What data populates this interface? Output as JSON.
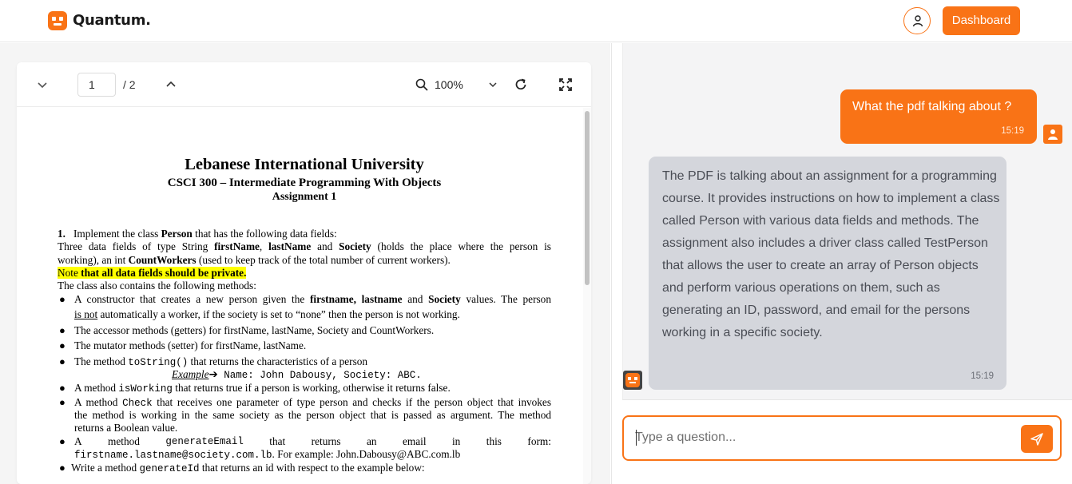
{
  "header": {
    "brand": "Quantum.",
    "dashboard_label": "Dashboard",
    "accent": "#f97316"
  },
  "viewer": {
    "page_current": "1",
    "page_total": "/ 2",
    "zoom": "100%",
    "icons": [
      "chevron-down-icon",
      "chevron-up-icon",
      "search-icon",
      "refresh-icon",
      "fullscreen-icon"
    ]
  },
  "pdf": {
    "title": "Lebanese International University",
    "course": "CSCI 300 – Intermediate Programming With Objects",
    "assignment": "Assignment 1",
    "item1_num": "1.",
    "item1_a": "Implement the class ",
    "item1_b": "Person",
    "item1_c": " that has the following data fields:",
    "fields_a": "Three data fields of type String ",
    "fields_b": "firstName",
    "fields_c": ", ",
    "fields_d": "lastName",
    "fields_e": " and ",
    "fields_f": "Society",
    "fields_g": " (holds the place where the person is",
    "working_a": "working), an int ",
    "working_b": "CountWorkers",
    "working_c": " (used to keep track of the total number of current workers).",
    "note_a": "Note ",
    "note_b": "that all data fields should be private.",
    "methods_intro": "The class also contains the following methods:",
    "b1_a": "A constructor that creates a new person given the ",
    "b1_b": "firstname, lastname",
    "b1_c": " and ",
    "b1_d": "Society",
    "b1_e": " values.  The person",
    "b1_f": "is not",
    "b1_g": " automatically a worker, if the society is set to “none” then the person is not working.",
    "b2": "The accessor methods (getters) for firstName, lastName, Society and CountWorkers.",
    "b3": "The mutator methods (setter) for firstName, lastName.",
    "b4_a": "The method ",
    "b4_b": "toString()",
    "b4_c": " that returns the characteristics of a person",
    "example_label": "Example",
    "example_arrow": "➔",
    "example_text": " Name: John Dabousy, Society: ABC.",
    "b5_a": "A method ",
    "b5_b": "isWorking",
    "b5_c": " that returns true if a person is working, otherwise it returns false.",
    "b6_a": "A method ",
    "b6_b": "Check",
    "b6_c": " that receives one parameter of type person and checks if the person object that invokes",
    "b6_d": "the method is working in the same society as the person object that is passed as argument. The method",
    "b6_e": "returns a Boolean value.",
    "b7_a": "A",
    "b7_b": "method",
    "b7_c": "generateEmail",
    "b7_d": "that",
    "b7_e": "returns",
    "b7_f": "an",
    "b7_g": "email",
    "b7_h": "in",
    "b7_i": "this",
    "b7_j": "form:",
    "b7_k": "firstname.lastname@society.com.lb",
    "b7_l": ". For example: John.Dabousy@ABC.com.lb",
    "b8_a": "Write a method ",
    "b8_b": "generateId",
    "b8_c": " that returns an id with respect to the example below:"
  },
  "chat": {
    "user_message": "What the pdf talking about ?",
    "user_time": "15:19",
    "bot_message": "The PDF is talking about an assignment for a programming course. It provides instructions on how to implement a class called Person with various data fields and methods. The assignment also includes a driver class called TestPerson that allows the user to create an array of Person objects and perform various operations on them, such as generating an ID, password, and email for the persons working in a specific society.",
    "bot_time": "15:19",
    "input_placeholder": "Type a question..."
  }
}
